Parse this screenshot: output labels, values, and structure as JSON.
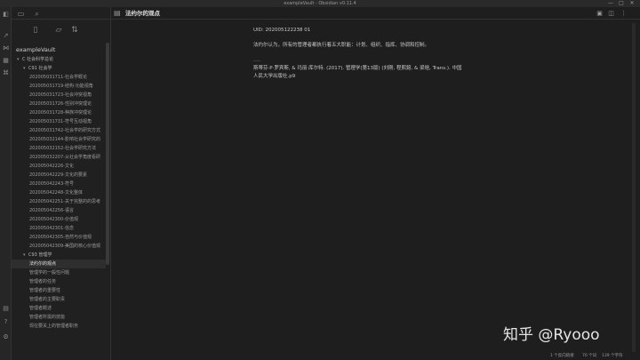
{
  "window": {
    "title": "exampleVault - Obsidian v0.11.4",
    "minimize": "—",
    "maximize": "□",
    "close": "✕"
  },
  "ribbon": {
    "icons": [
      "open-quick-switcher-icon",
      "graph-view-icon",
      "calendar-icon",
      "command-palette-icon",
      "templates-icon",
      "settings-icon",
      "help-icon",
      "vault-switch-icon"
    ]
  },
  "sidebar": {
    "top_icons": [
      "folder-icon",
      "search-icon"
    ],
    "actions": [
      "new-note-icon",
      "new-folder-icon",
      "sort-icon"
    ],
    "vault_name": "exampleVault",
    "tree": [
      {
        "label": "C 社会科学总论",
        "level": 0,
        "folder": true
      },
      {
        "label": "C91 社会学",
        "level": 1,
        "folder": true
      },
      {
        "label": "202005031711-社会学概论",
        "level": 2
      },
      {
        "label": "202005031719-结构-功能视角",
        "level": 2
      },
      {
        "label": "202005031723-社会冲突视角",
        "level": 2
      },
      {
        "label": "202005031726-性别冲突理论",
        "level": 2
      },
      {
        "label": "202005031728-种族冲突理论",
        "level": 2
      },
      {
        "label": "202005031731-符号互动视角",
        "level": 2
      },
      {
        "label": "202005031742-社会学的研究方式",
        "level": 2
      },
      {
        "label": "202005032144-影响社会学研究的",
        "level": 2
      },
      {
        "label": "202005032152-社会学研究方法",
        "level": 2
      },
      {
        "label": "202005032207-从社会学角度看研",
        "level": 2
      },
      {
        "label": "202005042226-文化",
        "level": 2
      },
      {
        "label": "202005042229-文化的要素",
        "level": 2
      },
      {
        "label": "202005042243-符号",
        "level": 2
      },
      {
        "label": "202005042248-文化整体",
        "level": 2
      },
      {
        "label": "202005042251-关于完整的的思考",
        "level": 2
      },
      {
        "label": "202005042256-语言",
        "level": 2
      },
      {
        "label": "202005042300-价值观",
        "level": 2
      },
      {
        "label": "202005042301-信念",
        "level": 2
      },
      {
        "label": "202005042305-自然与价值观",
        "level": 2
      },
      {
        "label": "202005042309-美国的核心价值观",
        "level": 2
      },
      {
        "label": "C93 管理学",
        "level": 1,
        "folder": true
      },
      {
        "label": "法约尔的观点",
        "level": 2,
        "active": true
      },
      {
        "label": "管理学的一般性问题",
        "level": 2
      },
      {
        "label": "管理者的任务",
        "level": 2
      },
      {
        "label": "管理者的重要性",
        "level": 2
      },
      {
        "label": "管理者的主要职责",
        "level": 2
      },
      {
        "label": "管理者概述",
        "level": 2
      },
      {
        "label": "管理者所需的技能",
        "level": 2
      },
      {
        "label": "现在要关上的管理者职务",
        "level": 2
      }
    ]
  },
  "tab": {
    "title": "法约尔的观点",
    "actions": [
      "preview-toggle-icon",
      "split-pane-icon",
      "more-options-icon"
    ]
  },
  "note": {
    "uid": "UID: 202005122238 01",
    "line1": "法约尔认为，所有的管理者都执行着五大职能：计划、组织、指挥、协调和控制。",
    "separator": "----",
    "ref1": "斯蒂芬·P·罗宾斯, & 玛丽·库尔特. (2017). 管理学(第13版) (刘刚, 程熙鎔, & 梁晗, Trans.). 中国",
    "ref2": "人民大学出版社.p9"
  },
  "status": {
    "backlinks": "1 个反向链接",
    "words": "70 个词",
    "chars": "139 个字符"
  },
  "watermark": "知乎 @Ryooo"
}
